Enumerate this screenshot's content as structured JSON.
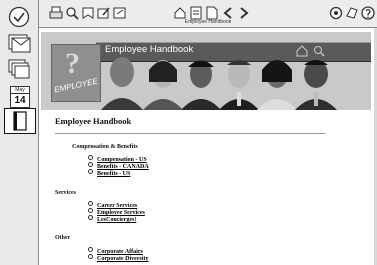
{
  "toolbar": {
    "caption": "Employee Handbook"
  },
  "rail": {
    "calendar_month": "May",
    "calendar_day": "14"
  },
  "banner": {
    "title": "Employee Handbook",
    "logo_text": "EMPLOYEE"
  },
  "page": {
    "title": "Employee Handbook",
    "sections": [
      {
        "heading": "Compensation & Benefits",
        "links": [
          "Compensation - US",
          "Benefits - CANADA",
          "Benefits - US"
        ]
      },
      {
        "heading": "Services",
        "links": [
          "Career Services",
          "Employee Services",
          "LesConcierges!"
        ]
      },
      {
        "heading": "Other",
        "links": [
          "Corporate Affairs",
          "Corporate Diversity"
        ]
      }
    ]
  }
}
